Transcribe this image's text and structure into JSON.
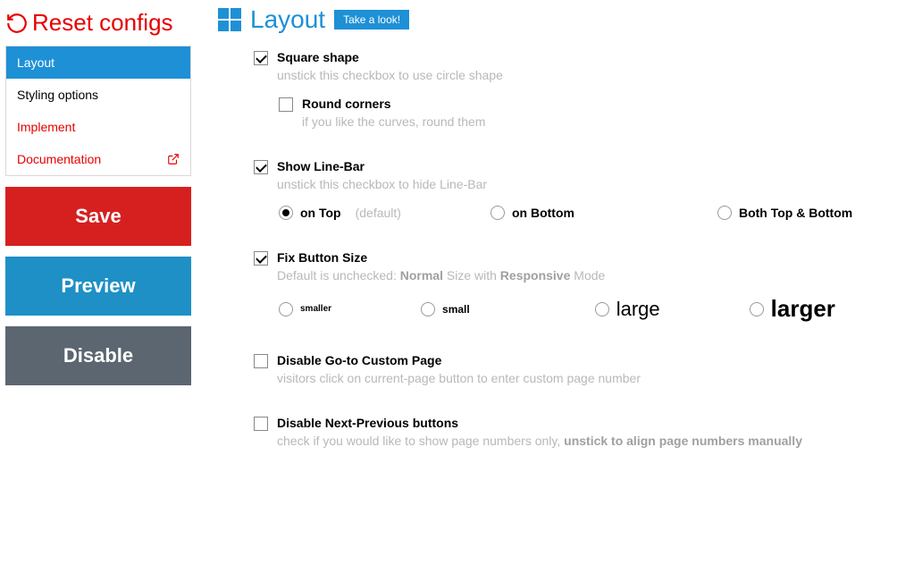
{
  "sidebar": {
    "reset_label": "Reset configs",
    "nav": [
      {
        "label": "Layout"
      },
      {
        "label": "Styling options"
      },
      {
        "label": "Implement"
      },
      {
        "label": "Documentation"
      }
    ],
    "save_label": "Save",
    "preview_label": "Preview",
    "disable_label": "Disable"
  },
  "header": {
    "title": "Layout",
    "take_look": "Take a look!"
  },
  "options": {
    "square": {
      "label": "Square shape",
      "desc": "unstick this checkbox to use circle shape"
    },
    "round": {
      "label": "Round corners",
      "desc": "if you like the curves, round them"
    },
    "linebar": {
      "label": "Show Line-Bar",
      "desc": "unstick this checkbox to hide Line-Bar",
      "top": "on Top",
      "default": "(default)",
      "bottom": "on Bottom",
      "both": "Both Top & Bottom"
    },
    "fix_size": {
      "label": "Fix Button Size",
      "desc_pre": "Default is unchecked: ",
      "desc_b1": "Normal",
      "desc_mid": " Size with ",
      "desc_b2": "Responsive",
      "desc_post": " Mode",
      "smaller": "smaller",
      "small": "small",
      "large": "large",
      "larger": "larger"
    },
    "disable_goto": {
      "label": "Disable Go-to Custom Page",
      "desc": "visitors click on current-page button to enter custom page number"
    },
    "disable_np": {
      "label": "Disable Next-Previous buttons",
      "desc_pre": "check if you would like to show page numbers only, ",
      "desc_b": "unstick to align page numbers manually"
    }
  }
}
